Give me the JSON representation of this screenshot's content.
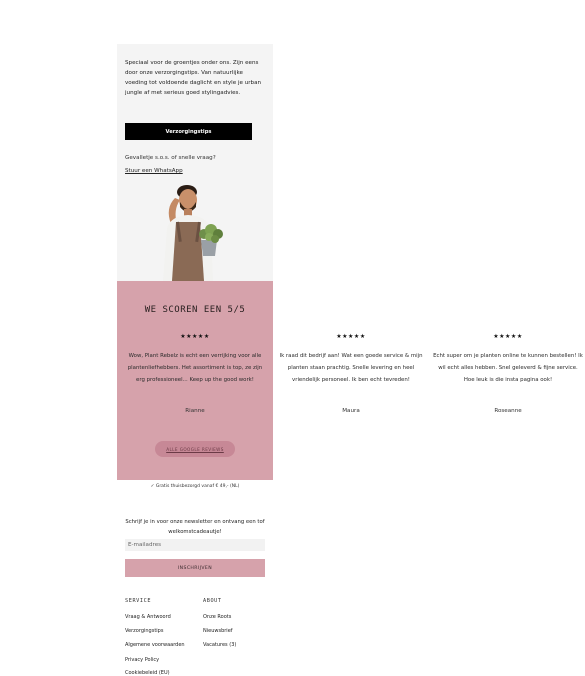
{
  "care": {
    "text": "Speciaal voor de groentjes onder ons. Zijn eens door onze verzorgingstips. Van natuurlijke voeding tot voldoende daglicht en style je urban jungle af met serieus goed stylingadvies.",
    "button_label": "Verzorgingstips",
    "sos_text": "Gevalletje s.o.s. of snelle vraag?",
    "whatsapp_link": "Stuur een WhatsApp"
  },
  "reviews": {
    "title": "WE SCOREN EEN 5/5",
    "items": [
      {
        "stars": "★★★★★",
        "text": "Wow, Plant Rebelz is echt een verrijking voor alle plantenliefhebbers. Het assortiment is top, ze zijn erg professioneel... Keep up the good work!",
        "author": "Rianne"
      },
      {
        "stars": "★★★★★",
        "text": "Ik raad dit bedrijf aan! Wat een goede service & mijn planten staan prachtig. Snelle levering en heel vriendelijk personeel. Ik ben echt tevreden!",
        "author": "Maura"
      },
      {
        "stars": "★★★★★",
        "text": "Echt super om je planten online te kunnen bestellen! Ik wil echt alles hebben. Snel geleverd & fijne service. Hoe leuk is die insta pagina ook!",
        "author": "Roseanne"
      }
    ],
    "google_button": "ALLE GOOGLE REVIEWS"
  },
  "shipping": "Gratis thuisbezorgd vanaf € 49,- (NL)",
  "newsletter": {
    "text": "Schrijf je in voor onze newsletter en ontvang een tof welkomstcadeautje!",
    "placeholder": "E-mailadres",
    "button": "INSCHRIJVEN"
  },
  "footer": {
    "service_title": "SERVICE",
    "service_links": [
      "Vraag & Antwoord",
      "Verzorgingstips",
      "Algemene voorwaarden",
      "Privacy Policy",
      "Cookiebeleid (EU)"
    ],
    "about_title": "ABOUT",
    "about_links": [
      "Onze Roots",
      "Nieuwsbrief",
      "Vacatures (3)"
    ]
  },
  "colors": {
    "pink": "#d6a2ab",
    "button_black": "#000000",
    "care_bg": "#f4f4f4"
  }
}
